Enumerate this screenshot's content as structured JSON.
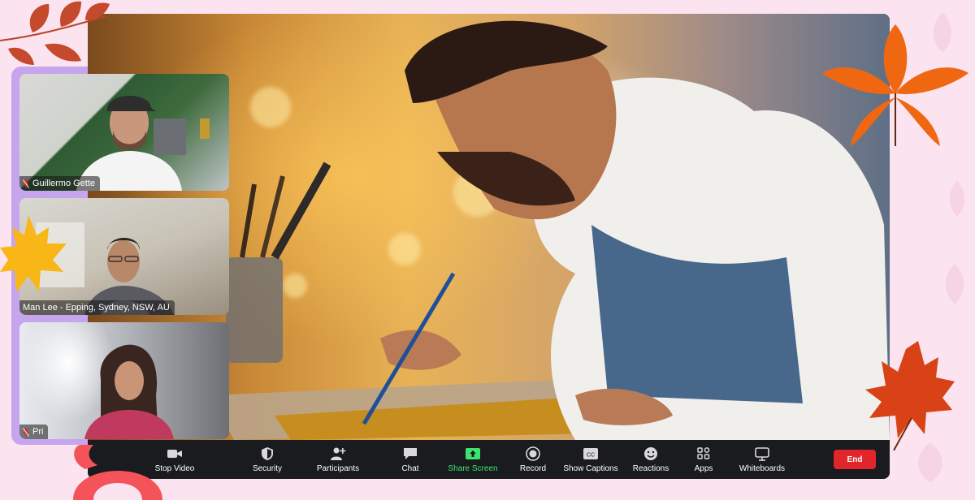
{
  "meeting": {
    "participants": [
      {
        "name": "Guillermo Gette",
        "muted": true
      },
      {
        "name": "Man Lee -  Epping, Sydney, NSW, AU",
        "muted": false
      },
      {
        "name": "Pri",
        "muted": true
      }
    ]
  },
  "toolbar": {
    "stop_video": "Stop Video",
    "security": "Security",
    "participants": "Participants",
    "chat": "Chat",
    "share_screen": "Share Screen",
    "record": "Record",
    "show_captions": "Show Captions",
    "reactions": "Reactions",
    "apps": "Apps",
    "whiteboards": "Whiteboards",
    "end": "End"
  },
  "colors": {
    "background": "#fbe3ef",
    "panel": "#c7a5ee",
    "toolbar": "#1a1b1f",
    "share_accent": "#3be36f",
    "end_button": "#e0262b",
    "muted_icon": "#e0262b"
  },
  "icons": [
    "video-camera-icon",
    "shield-icon",
    "person-add-icon",
    "chat-bubble-icon",
    "share-screen-icon",
    "record-icon",
    "closed-captions-icon",
    "smiley-icon",
    "apps-icon",
    "whiteboard-icon",
    "muted-mic-icon"
  ]
}
